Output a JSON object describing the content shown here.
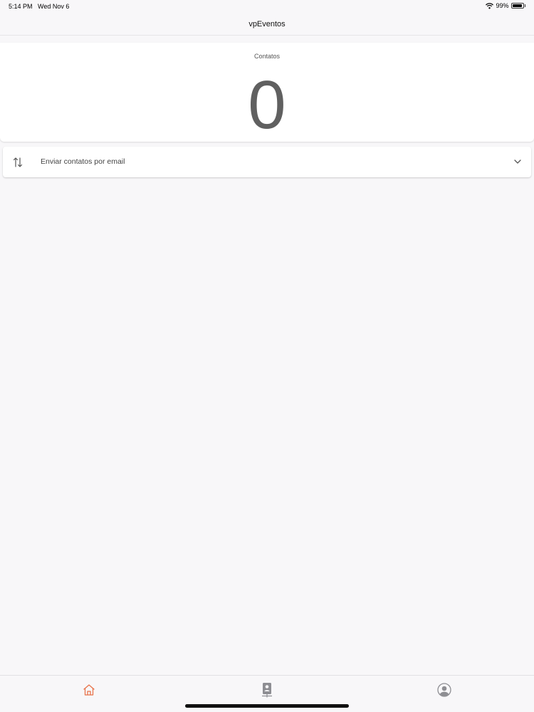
{
  "status_bar": {
    "time": "5:14 PM",
    "date": "Wed Nov 6",
    "battery_percent_label": "99%",
    "battery_level": 0.99
  },
  "nav": {
    "title": "vpEventos"
  },
  "counter": {
    "label": "Contatos",
    "value": "0"
  },
  "accordion": {
    "label": "Enviar contatos por email",
    "icon": "swap-vertical-icon",
    "chevron": "chevron-down-icon",
    "expanded": false
  },
  "tab_bar": {
    "tabs": [
      {
        "id": "home",
        "icon": "home-icon",
        "active": true
      },
      {
        "id": "badge",
        "icon": "id-badge-icon",
        "active": false
      },
      {
        "id": "profile",
        "icon": "user-circle-icon",
        "active": false
      }
    ],
    "active_color": "#e8734a",
    "inactive_color": "#8e8e93"
  }
}
